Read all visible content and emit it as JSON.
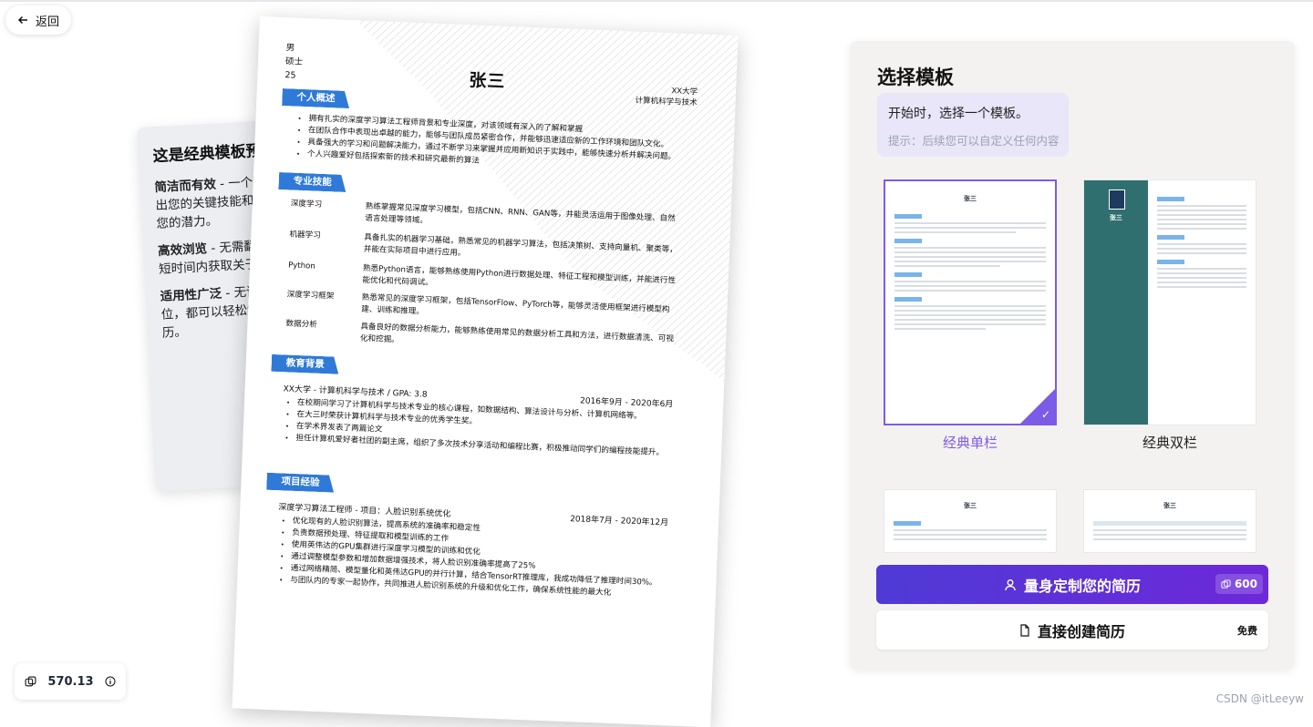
{
  "nav": {
    "back_label": "返回"
  },
  "preview": {
    "title": "这是经典模板预览",
    "points": [
      {
        "head": "简洁而有效",
        "text": " - 一个紧凑而清晰的方式来突出您的关键技能和经验，让雇主快速了解您的潜力。"
      },
      {
        "head": "高效浏览",
        "text": " - 无需翻阅多页，使雇主能够在短时间内获取关于您的最重要信息。"
      },
      {
        "head": "适用性广泛",
        "text": " - 无论求职类型，无论求职岗位，都可以轻松制作一份引人注目的简历。"
      }
    ]
  },
  "resume": {
    "gender": "男",
    "degree": "硕士",
    "age": "25",
    "name": "张三",
    "school": "XX大学",
    "major": "计算机科学与技术",
    "sections": {
      "summary": "个人概述",
      "skills": "专业技能",
      "education": "教育背景",
      "projects": "项目经验"
    },
    "summary_items": [
      "拥有扎实的深度学习算法工程师背景和专业深度，对该领域有深入的了解和掌握",
      "在团队合作中表现出卓越的能力，能够与团队成员紧密合作，并能够迅速适应新的工作环境和团队文化。",
      "具备强大的学习和问题解决能力，通过不断学习来掌握并应用新知识于实践中，能够快速分析并解决问题。",
      "个人兴趣爱好包括探索新的技术和研究最新的算法"
    ],
    "skills": [
      {
        "k": "深度学习",
        "v": "熟练掌握常见深度学习模型，包括CNN、RNN、GAN等，并能灵活运用于图像处理、自然语言处理等领域。"
      },
      {
        "k": "机器学习",
        "v": "具备扎实的机器学习基础，熟悉常见的机器学习算法，包括决策树、支持向量机、聚类等，并能在实际项目中进行应用。"
      },
      {
        "k": "Python",
        "v": "熟悉Python语言，能够熟练使用Python进行数据处理、特征工程和模型训练，并能进行性能优化和代码调试。"
      },
      {
        "k": "深度学习框架",
        "v": "熟悉常见的深度学习框架，包括TensorFlow、PyTorch等，能够灵活使用框架进行模型构建、训练和推理。"
      },
      {
        "k": "数据分析",
        "v": "具备良好的数据分析能力，能够熟练使用常见的数据分析工具和方法，进行数据清洗、可视化和挖掘。"
      }
    ],
    "edu_title": "XX大学 - 计算机科学与技术 / GPA: 3.8",
    "edu_date": "2016年9月 - 2020年6月",
    "edu_items": [
      "在校期间学习了计算机科学与技术专业的核心课程，如数据结构、算法设计与分析、计算机网络等。",
      "在大三时荣获计算机科学与技术专业的优秀学生奖。",
      "在学术界发表了两篇论文",
      "担任计算机爱好者社团的副主席，组织了多次技术分享活动和编程比赛，积极推动同学们的编程技能提升。"
    ],
    "proj_title": "深度学习算法工程师 - 项目：人脸识别系统优化",
    "proj_date": "2018年7月 - 2020年12月",
    "proj_items": [
      "优化现有的人脸识别算法，提高系统的准确率和稳定性",
      "负责数据预处理、特征提取和模型训练的工作",
      "使用英伟达的GPU集群进行深度学习模型的训练和优化",
      "通过调整模型参数和增加数据增强技术，将人脸识别准确率提高了25%",
      "通过网络精简、模型量化和英伟达GPU的并行计算，结合TensorRT推理库，我成功降低了推理时间30%。",
      "与团队内的专家一起协作，共同推进人脸识别系统的升级和优化工作，确保系统性能的最大化"
    ]
  },
  "panel": {
    "title": "选择模板",
    "hint_main": "开始时，选择一个模板。",
    "hint_sub": "提示：后续您可以自定义任何内容",
    "templates": [
      {
        "label": "经典单栏",
        "selected": true
      },
      {
        "label": "经典双栏",
        "selected": false
      }
    ],
    "custom_button": "量身定制您的简历",
    "custom_cost": "600",
    "direct_button": "直接创建简历",
    "direct_cost": "免费"
  },
  "credits": {
    "value": "570.13"
  },
  "watermark": "CSDN @itLeeyw",
  "colors": {
    "accent": "#7c5ce6",
    "section_blue": "#2f7ad8",
    "sidebar_teal": "#2f6f6f"
  }
}
